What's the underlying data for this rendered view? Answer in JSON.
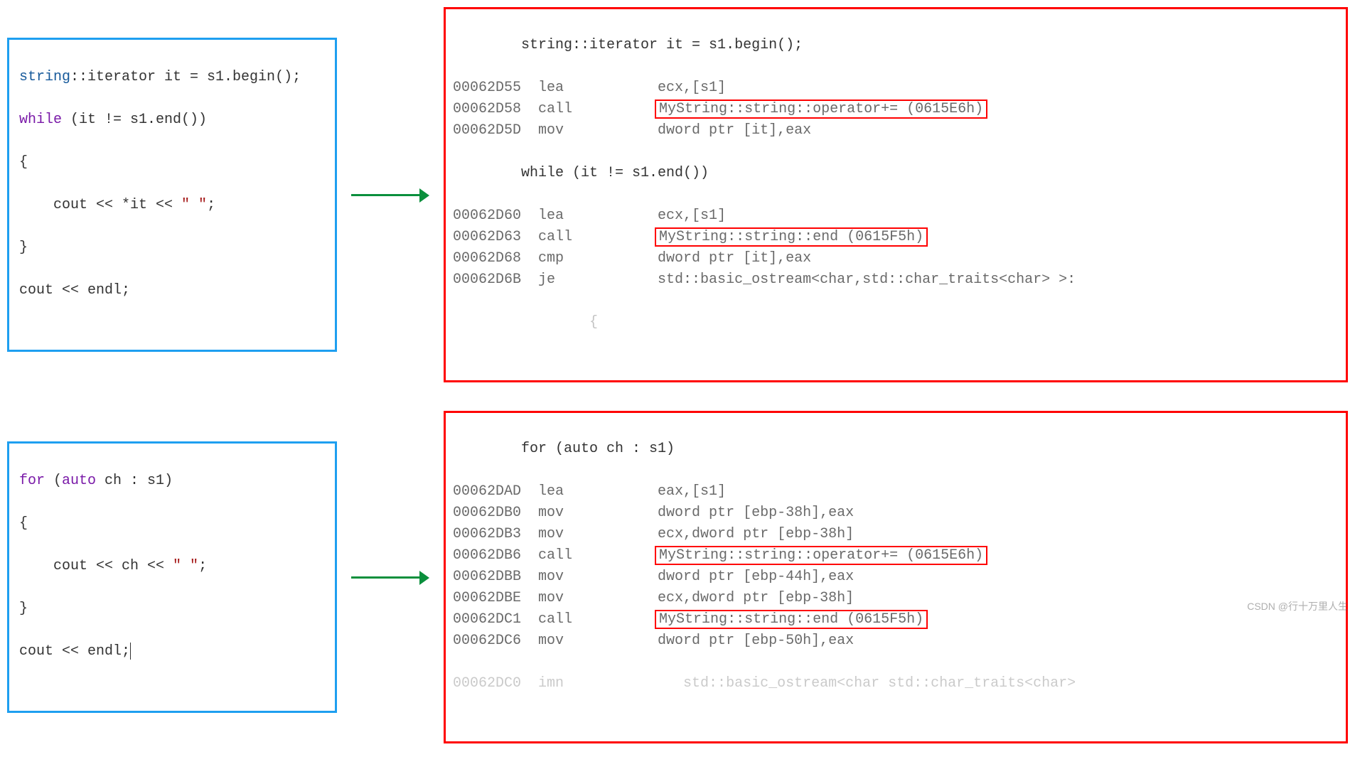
{
  "watermark": "CSDN @行十万里人生",
  "block1": {
    "code": {
      "l1_type": "string",
      "l1_rest": "::iterator it = s1.begin();",
      "l2_kw": "while",
      "l2_rest": " (it != s1.end())",
      "l3": "{",
      "l4_a": "    cout << *it << ",
      "l4_str": "\" \"",
      "l4_b": ";",
      "l5": "}",
      "l6": "cout << endl;"
    },
    "asm": {
      "src1": "        string::iterator it = s1.begin();",
      "lines": [
        {
          "addr": "00062D55",
          "op": "lea",
          "args": "ecx,[s1]",
          "hl": null
        },
        {
          "addr": "00062D58",
          "op": "call",
          "args": "",
          "hl": "MyString::string::operator+= (0615E6h)"
        },
        {
          "addr": "00062D5D",
          "op": "mov",
          "args": "dword ptr [it],eax",
          "hl": null
        }
      ],
      "src2": "        while (it != s1.end())",
      "lines2": [
        {
          "addr": "00062D60",
          "op": "lea",
          "args": "ecx,[s1]",
          "hl": null
        },
        {
          "addr": "00062D63",
          "op": "call",
          "args": "",
          "hl": "MyString::string::end (0615F5h)"
        },
        {
          "addr": "00062D68",
          "op": "cmp",
          "args": "dword ptr [it],eax",
          "hl": null
        },
        {
          "addr": "00062D6B",
          "op": "je",
          "args": "std::basic_ostream<char,std::char_traits<char> >:",
          "hl": null
        }
      ],
      "cut": "                {"
    }
  },
  "block2": {
    "code": {
      "l1_kw": "for",
      "l1_a": " (",
      "l1_auto": "auto",
      "l1_b": " ch : s1)",
      "l2": "{",
      "l3_a": "    cout << ch << ",
      "l3_str": "\" \"",
      "l3_b": ";",
      "l4": "}",
      "l5": "cout << endl;"
    },
    "asm": {
      "src1": "        for (auto ch : s1)",
      "lines": [
        {
          "addr": "00062DAD",
          "op": "lea",
          "args": "eax,[s1]",
          "hl": null
        },
        {
          "addr": "00062DB0",
          "op": "mov",
          "args": "dword ptr [ebp-38h],eax",
          "hl": null
        },
        {
          "addr": "00062DB3",
          "op": "mov",
          "args": "ecx,dword ptr [ebp-38h]",
          "hl": null
        },
        {
          "addr": "00062DB6",
          "op": "call",
          "args": "",
          "hl": "MyString::string::operator+= (0615E6h)"
        },
        {
          "addr": "00062DBB",
          "op": "mov",
          "args": "dword ptr [ebp-44h],eax",
          "hl": null
        },
        {
          "addr": "00062DBE",
          "op": "mov",
          "args": "ecx,dword ptr [ebp-38h]",
          "hl": null
        },
        {
          "addr": "00062DC1",
          "op": "call",
          "args": "",
          "hl": "MyString::string::end (0615F5h)"
        },
        {
          "addr": "00062DC6",
          "op": "mov",
          "args": "dword ptr [ebp-50h],eax",
          "hl": null
        }
      ],
      "cut": "00062DC0  imn              std::basic_ostream<char std::char_traits<char> "
    }
  }
}
